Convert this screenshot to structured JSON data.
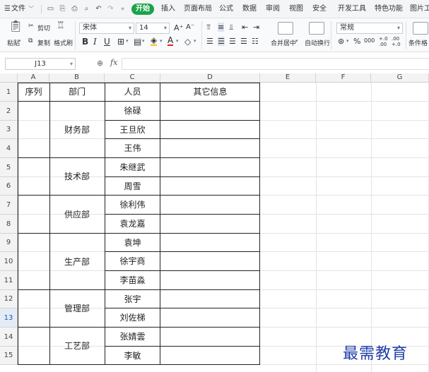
{
  "menubar": {
    "file_label": "文件",
    "start_label": "开始",
    "tabs": [
      "插入",
      "页面布局",
      "公式",
      "数据",
      "审阅",
      "视图",
      "安全",
      "开发工具",
      "特色功能",
      "图片工"
    ]
  },
  "ribbon": {
    "paste_label": "粘贴",
    "cut_label": "剪切",
    "copy_label": "复制",
    "format_painter_label": "格式刷",
    "font_name": "宋体",
    "font_size": "14",
    "font_grow": "A⁺",
    "font_shrink": "A⁻",
    "bold": "B",
    "italic": "I",
    "underline": "U",
    "merge_label": "合并居中",
    "wrap_label": "自动换行",
    "number_format": "常规",
    "percent": "%",
    "thousands": "000",
    "inc_decimal": "+.0\n.00",
    "dec_decimal": ".00\n+.0",
    "cond_format_label": "条件格"
  },
  "formula_bar": {
    "cell_ref": "J13",
    "fx_label": "fx",
    "formula_value": ""
  },
  "sheet": {
    "columns": [
      "A",
      "B",
      "C",
      "D",
      "E",
      "F",
      "G"
    ],
    "rows": [
      "1",
      "2",
      "3",
      "4",
      "5",
      "6",
      "7",
      "8",
      "9",
      "10",
      "11",
      "12",
      "13",
      "14",
      "15"
    ],
    "active_row": "13",
    "headers": {
      "seq": "序列",
      "dept": "部门",
      "person": "人员",
      "other": "其它信息"
    },
    "departments": [
      {
        "name": "财务部",
        "people": [
          "徐碌",
          "王旦欣",
          "王伟"
        ]
      },
      {
        "name": "技术部",
        "people": [
          "朱继武",
          "周雪"
        ]
      },
      {
        "name": "供应部",
        "people": [
          "徐利伟",
          "袁龙嘉"
        ]
      },
      {
        "name": "生产部",
        "people": [
          "袁坤",
          "徐宇商",
          "李苗淼"
        ]
      },
      {
        "name": "管理部",
        "people": [
          "张宇",
          "刘佐梯"
        ]
      },
      {
        "name": "工艺部",
        "people": [
          "张婧雲",
          "李敏"
        ]
      }
    ]
  },
  "watermark": "最需教育"
}
